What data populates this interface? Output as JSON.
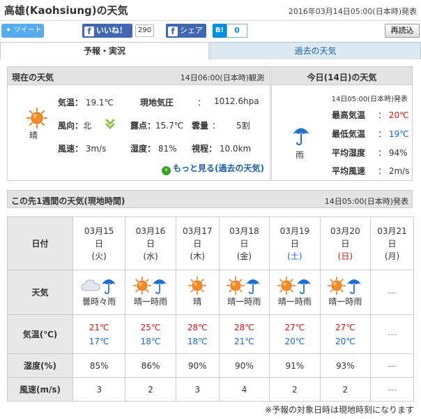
{
  "header": {
    "title": "高雄(Kaohsiung)の天気",
    "issued": "2016年03月14日05:00(日本時)発表"
  },
  "social": {
    "tweet": "ツイート",
    "like": "いいね！",
    "like_count": "290",
    "share": "シェア",
    "hatena_mark": "B!",
    "hatena_count": "0",
    "reload": "再読込"
  },
  "tabs": {
    "forecast": "予報・実況",
    "past": "過去の天気"
  },
  "current": {
    "title": "現在の天気",
    "observed": "14日06:00(日本時)観測",
    "condition": "晴",
    "temp_label": "気温：",
    "temp_value": "19.1℃",
    "pressure_label": "現地気圧",
    "pressure_sep": "：",
    "pressure_value": "1012.6hpa",
    "wind_dir_label": "風向：",
    "wind_dir_value": "北",
    "dew_label": "露点：",
    "dew_value": "15.7℃",
    "cloud_label": "雲量",
    "cloud_sep": "：",
    "cloud_value": "5割",
    "wind_speed_label": "風速：",
    "wind_speed_value": "3m/s",
    "humidity_label": "湿度：",
    "humidity_value": "81%",
    "visibility_label": "視程：",
    "visibility_value": "10.0km",
    "more": "もっと見る(過去の天気)"
  },
  "today": {
    "title": "今日(14日)の天気",
    "issued": "14日05:00(日本時)発表",
    "condition": "雨",
    "max_label": "最高気温",
    "max_value": "20℃",
    "min_label": "最低気温",
    "min_value": "19℃",
    "humidity_label": "平均湿度",
    "humidity_value": "94%",
    "wind_label": "平均風速",
    "wind_value": "2m/s",
    "sep": "："
  },
  "week": {
    "title": "この先1週間の天気(現地時間)",
    "issued": "14日05:00(日本時)発表",
    "row_labels": {
      "date": "日付",
      "weather": "天気",
      "temp": "気温(℃)",
      "humidity": "湿度(%)",
      "wind": "風速(m/s)"
    },
    "days": [
      {
        "date": "03月15",
        "day": "日",
        "dow": "(火)",
        "dow_color": "#333",
        "weather": "曇時々雨",
        "icons": [
          "cloud-icon",
          "umbrella-icon"
        ],
        "max": "21℃",
        "min": "17℃",
        "humidity": "85%",
        "wind": "3"
      },
      {
        "date": "03月16",
        "day": "日",
        "dow": "(水)",
        "dow_color": "#333",
        "weather": "晴一時雨",
        "icons": [
          "sun-icon",
          "umbrella-icon"
        ],
        "max": "25℃",
        "min": "18℃",
        "humidity": "86%",
        "wind": "2"
      },
      {
        "date": "03月17",
        "day": "日",
        "dow": "(木)",
        "dow_color": "#333",
        "weather": "晴",
        "icons": [
          "sun-icon"
        ],
        "max": "28℃",
        "min": "18℃",
        "humidity": "90%",
        "wind": "3"
      },
      {
        "date": "03月18",
        "day": "日",
        "dow": "(金)",
        "dow_color": "#333",
        "weather": "晴一時雨",
        "icons": [
          "sun-icon",
          "umbrella-icon"
        ],
        "max": "28℃",
        "min": "21℃",
        "humidity": "90%",
        "wind": "4"
      },
      {
        "date": "03月19",
        "day": "日",
        "dow": "(土)",
        "dow_color": "#1565e0",
        "weather": "晴一時雨",
        "icons": [
          "sun-icon",
          "umbrella-icon"
        ],
        "max": "27℃",
        "min": "20℃",
        "humidity": "91%",
        "wind": "2"
      },
      {
        "date": "03月20",
        "day": "日",
        "dow": "(日)",
        "dow_color": "#e01010",
        "weather": "晴一時雨",
        "icons": [
          "sun-icon",
          "umbrella-icon"
        ],
        "max": "27℃",
        "min": "20℃",
        "humidity": "93%",
        "wind": "2"
      },
      {
        "date": "03月21",
        "day": "日",
        "dow": "(月)",
        "dow_color": "#333",
        "weather": "---",
        "icons": [],
        "max": "---",
        "min": "",
        "humidity": "---",
        "wind": "---"
      }
    ]
  },
  "footnote": "※予報の対象日時は現地時刻になります",
  "colors": {
    "max_temp": "#e01010",
    "min_temp": "#1565e0",
    "sun": "#f08020",
    "umbrella": "#1e6fd0"
  }
}
